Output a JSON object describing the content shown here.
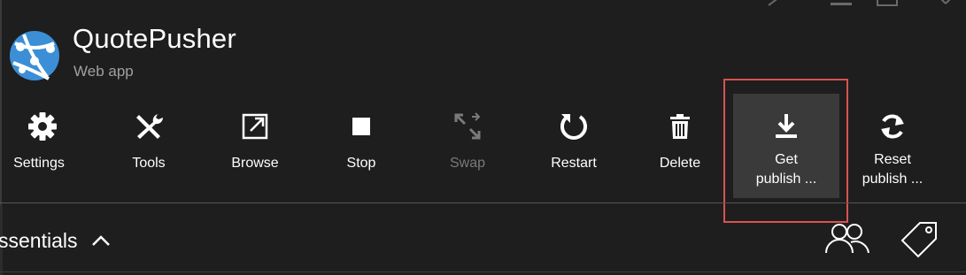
{
  "header": {
    "title": "QuotePusher",
    "subtitle": "Web app",
    "icon": "web-app-globe-icon",
    "icon_color": "#3c8fd6"
  },
  "window_controls": [
    "pin-icon",
    "minimize-icon",
    "maximize-icon",
    "close-icon"
  ],
  "toolbar": {
    "settings": {
      "label": "Settings",
      "icon": "gear-icon"
    },
    "tools": {
      "label": "Tools",
      "icon": "wrench-screwdriver-icon"
    },
    "browse": {
      "label": "Browse",
      "icon": "external-link-icon"
    },
    "stop": {
      "label": "Stop",
      "icon": "stop-icon"
    },
    "swap": {
      "label": "Swap",
      "icon": "swap-icon",
      "disabled": true
    },
    "restart": {
      "label": "Restart",
      "icon": "restart-icon"
    },
    "delete": {
      "label": "Delete",
      "icon": "trash-icon"
    },
    "get_publish": {
      "label_line1": "Get",
      "label_line2": "publish ...",
      "icon": "download-icon",
      "highlighted": true
    },
    "reset_publish": {
      "label_line1": "Reset",
      "label_line2": "publish ...",
      "icon": "refresh-icon"
    }
  },
  "essentials": {
    "label": "ssentials",
    "chevron": "chevron-up-icon",
    "actions": [
      "users-icon",
      "tag-icon"
    ]
  },
  "colors": {
    "background": "#1e1e1e",
    "highlight": "#3a3a3a",
    "focus_outline": "#d9534f",
    "disabled_text": "#7a7a7a"
  }
}
